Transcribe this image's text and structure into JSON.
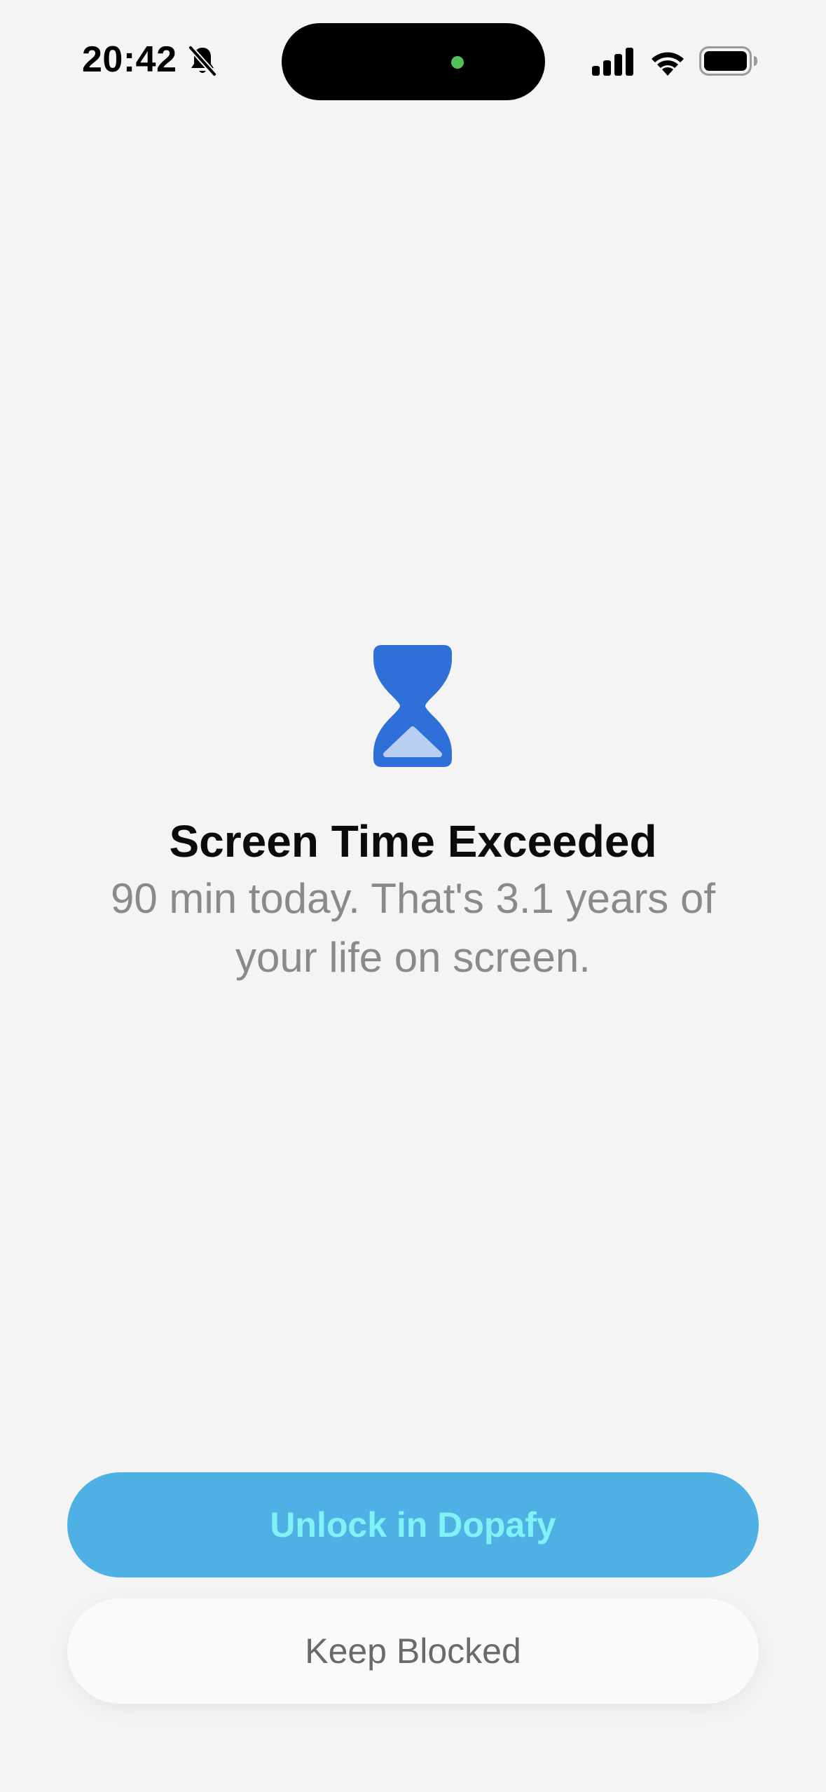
{
  "status_bar": {
    "time": "20:42",
    "icons": [
      "bell-slash-icon",
      "cellular-signal-icon",
      "wifi-icon",
      "battery-icon"
    ]
  },
  "main": {
    "icon": "hourglass-icon",
    "title": "Screen Time Exceeded",
    "subtitle": "90 min today. That's 3.1 years of your life on screen."
  },
  "actions": {
    "unlock_label": "Unlock in Dopafy",
    "keep_label": "Keep Blocked"
  },
  "colors": {
    "background": "#f4f4f5",
    "accent": "#2f6fd8",
    "unlock_button": "#4fb0e4",
    "unlock_text": "#7ff2f5",
    "subtitle_text": "#8a8a8e"
  }
}
